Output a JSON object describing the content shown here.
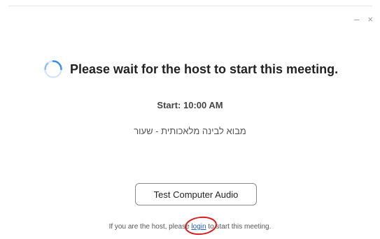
{
  "window": {
    "minimize_glyph": "–",
    "close_glyph": "×"
  },
  "status": {
    "heading": "Please wait for the host to start this meeting.",
    "icon": "loading-spinner-icon"
  },
  "meeting": {
    "start_label": "Start: 10:00 AM",
    "topic": "מבוא לבינה מלאכותית - שעור"
  },
  "actions": {
    "test_audio_label": "Test Computer Audio"
  },
  "host_prompt": {
    "before": "If you are the host, please ",
    "link": "login",
    "after": " to start this meeting."
  },
  "colors": {
    "link": "#1a5fd0",
    "spinner": "#3a8ef0",
    "annotation": "#d81e1e"
  }
}
